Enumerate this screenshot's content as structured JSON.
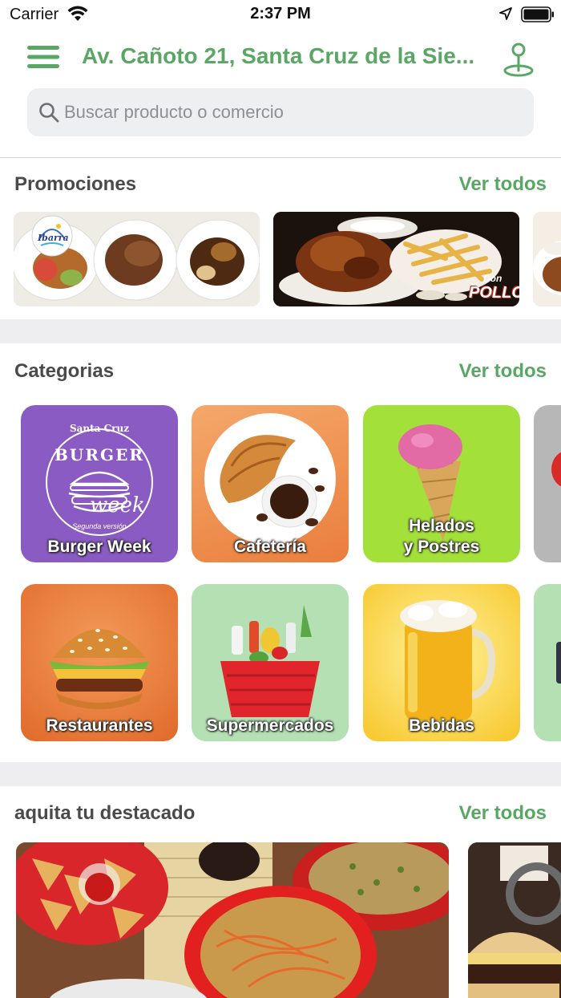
{
  "status_bar": {
    "carrier": "Carrier",
    "time": "2:37 PM"
  },
  "header": {
    "address": "Av. Cañoto 21, Santa Cruz de la Sie..."
  },
  "search": {
    "placeholder": "Buscar producto o comercio"
  },
  "promotions": {
    "title": "Promociones",
    "see_all": "Ver todos"
  },
  "categories": {
    "title": "Categorias",
    "see_all": "Ver todos",
    "items": [
      {
        "label": "Burger Week"
      },
      {
        "label": "Cafetería"
      },
      {
        "label_line1": "Helados",
        "label_line2": "y Postres"
      },
      {
        "label": "Restaurantes"
      },
      {
        "label": "Supermercados"
      },
      {
        "label": "Bebidas"
      }
    ],
    "burger_week_logo": {
      "top": "Santa Cruz",
      "word": "BURGER",
      "script": "week",
      "bottom": "Segunda versión"
    }
  },
  "featured": {
    "title": "aquita tu destacado",
    "see_all": "Ver todos"
  },
  "promo_logos": {
    "ibarra": "Ibarra",
    "don_pollo_1": "Don",
    "don_pollo_2": "POLLO"
  },
  "colors": {
    "accent": "#5aa765",
    "band": "#eeeef0",
    "purple_tile": "#8a5bc2",
    "lime_tile": "#a4e03a"
  }
}
